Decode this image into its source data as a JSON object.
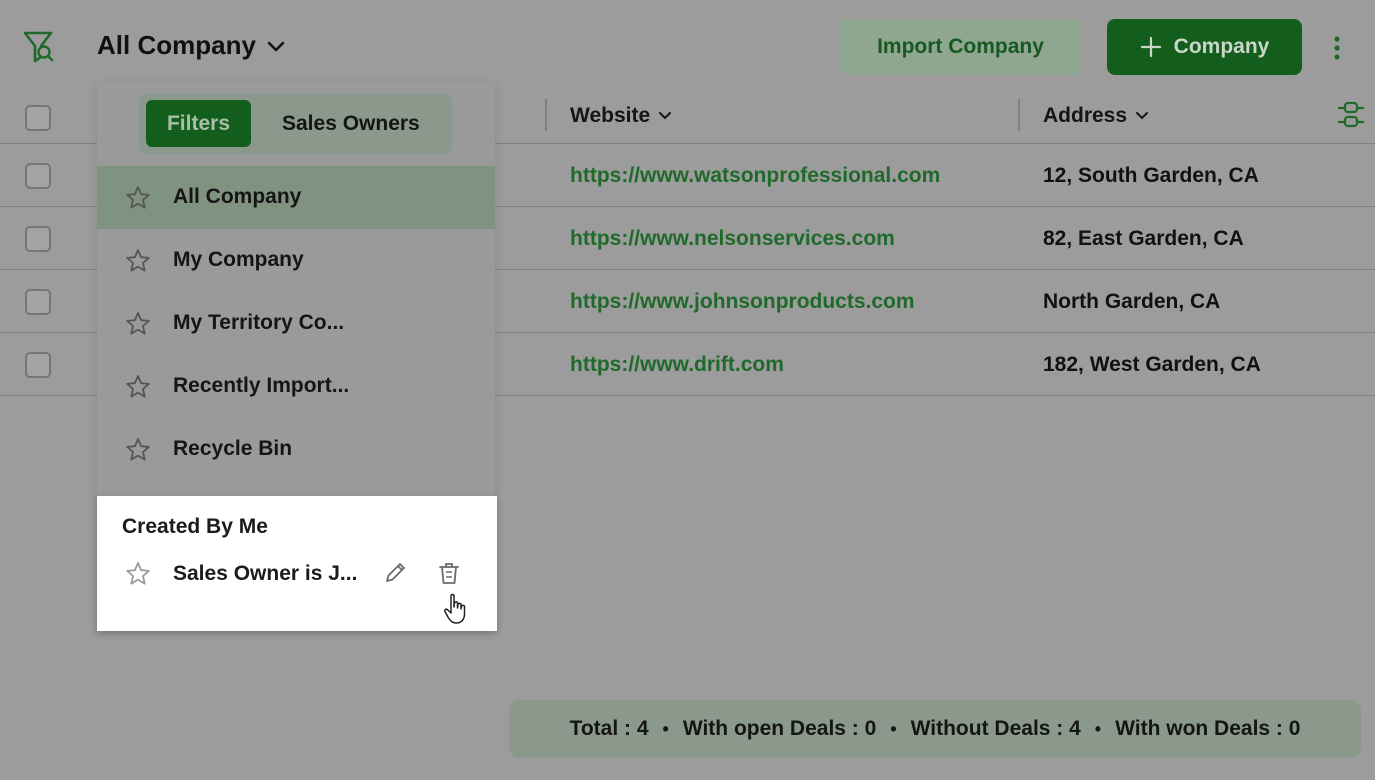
{
  "header": {
    "view_title": "All Company",
    "import_button": "Import Company",
    "add_button": "Company"
  },
  "table": {
    "columns": [
      "Website",
      "Address"
    ],
    "rows": [
      {
        "website": "https://www.watsonprofessional.com",
        "address": "12, South Garden, CA"
      },
      {
        "website": "https://www.nelsonservices.com",
        "address": "82, East Garden, CA"
      },
      {
        "website": "https://www.johnsonproducts.com",
        "address": "North Garden, CA"
      },
      {
        "website": "https://www.drift.com",
        "address": "182, West Garden, CA"
      }
    ]
  },
  "dropdown": {
    "tabs": {
      "filters": "Filters",
      "sales_owners": "Sales Owners"
    },
    "views": [
      "All Company",
      "My Company",
      "My Territory Co...",
      "Recently Import...",
      "Recycle Bin"
    ],
    "active_view": "All Company",
    "created_by_me": {
      "title": "Created By Me",
      "items": [
        "Sales Owner is J..."
      ]
    }
  },
  "summary": {
    "total": "Total : 4",
    "open_deals": "With open Deals : 0",
    "without_deals": "Without Deals : 4",
    "won_deals": "With won Deals : 0"
  },
  "colors": {
    "brand_green": "#145e1d",
    "link_green": "#1f6a2a",
    "overlay_gray": "#9c9c9c"
  }
}
